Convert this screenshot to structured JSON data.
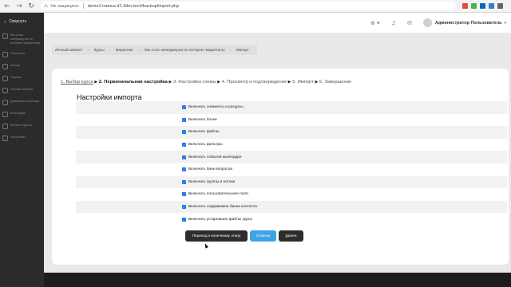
{
  "browser": {
    "back_icon": "back-arrow-icon",
    "security_label": "Не защищено",
    "url": "demo1.tramus.d1.3dev.tech/backup/import.php"
  },
  "sidebar": {
    "collapse_label": "Свернуть",
    "items": [
      {
        "label": "Как стать менеджером по интернет-маркетингу"
      },
      {
        "label": "Участники"
      },
      {
        "label": "Значки"
      },
      {
        "label": "Оценки"
      },
      {
        "label": "Личный кабинет"
      },
      {
        "label": "Домашняя страница"
      },
      {
        "label": "Календарь"
      },
      {
        "label": "Каталог курсов"
      },
      {
        "label": "Настройки"
      }
    ]
  },
  "header": {
    "user_name": "Администратор Пользователь"
  },
  "breadcrumb": [
    "Личный кабинет",
    "Курсы",
    "Маркетинг",
    "Как стать менеджером по интернет-маркетингу",
    "Импорт"
  ],
  "steps": {
    "s1": "1. Выбор курса",
    "s2": "2. Первоначальная настройка",
    "s3": "3. Настройка схемы",
    "s4": "4. Просмотр и подтверждение",
    "s5": "5. Импорт",
    "s6": "6. Завершение"
  },
  "section_title": "Настройки импорта",
  "settings": [
    {
      "label": "Включать элементы и ресурсы",
      "checked": true
    },
    {
      "label": "Включать блоки",
      "checked": true
    },
    {
      "label": "Включать файлы",
      "checked": true
    },
    {
      "label": "Включать фильтры",
      "checked": true
    },
    {
      "label": "Включать события календаря",
      "checked": true
    },
    {
      "label": "Включать банк вопросов",
      "checked": true
    },
    {
      "label": "Включать группы и потоки",
      "checked": true
    },
    {
      "label": "Включать пользовательские поля",
      "checked": true
    },
    {
      "label": "Включить содержимое банка контента",
      "checked": true
    },
    {
      "label": "Включать устаревшие файлы курса",
      "checked": true
    }
  ],
  "buttons": {
    "jump": "Переход к конечному этапу",
    "cancel": "Отмена",
    "next": "Далее"
  },
  "colors": {
    "accent": "#3fa3e6",
    "dark_button": "#2d2d2d",
    "checkbox": "#1a73e8"
  }
}
